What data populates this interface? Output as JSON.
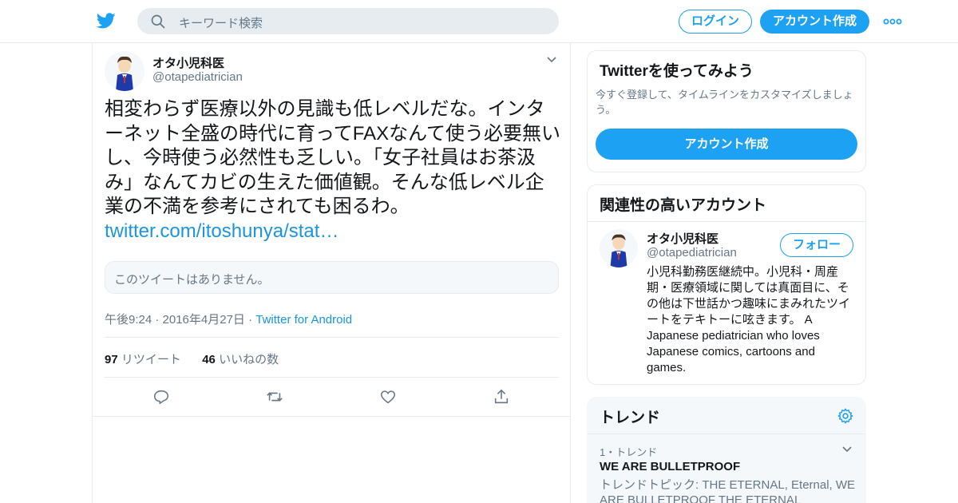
{
  "header": {
    "logo_icon": "twitter-bird-icon",
    "search_placeholder": "キーワード検索",
    "login_label": "ログイン",
    "signup_label": "アカウント作成",
    "more_icon": "more-dots-icon",
    "accent": "#1da1f2"
  },
  "tweet": {
    "author_name": "オタ小児科医",
    "author_handle": "@otapediatrician",
    "text": "相変わらず医療以外の見識も低レベルだな。インターネット全盛の時代に育ってFAXなんて使う必要無いし、今時使う必然性も乏しい。「女子社員はお茶汲み」なんてカビの生えた価値観。そんな低レベル企業の不満を参考にされても困るわ。",
    "link": "twitter.com/itoshunya/stat…",
    "quote_unavailable": "このツイートはありません。",
    "time": "午後9:24 · 2016年4月27日",
    "meta_separator": "·",
    "source": "Twitter for Android",
    "retweet_count": "97",
    "retweet_label": "リツイート",
    "like_count": "46",
    "like_label": "いいねの数",
    "actions": [
      "reply-icon",
      "retweet-icon",
      "like-icon",
      "share-icon"
    ]
  },
  "signup_card": {
    "title": "Twitterを使ってみよう",
    "description": "今すぐ登録して、タイムラインをカスタマイズしましょう。",
    "button": "アカウント作成"
  },
  "related": {
    "title": "関連性の高いアカウント",
    "name": "オタ小児科医",
    "handle": "@otapediatrician",
    "follow_label": "フォロー",
    "bio": "小児科勤務医継続中。小児科・周産期・医療領域に関しては真面目に、その他は下世話かつ趣味にまみれたツイートをテキトーに呟きます。 A Japanese pediatrician who loves Japanese comics, cartoons and games."
  },
  "trends": {
    "title": "トレンド",
    "settings_icon": "gear-icon",
    "rank_label": "1・トレンド",
    "name": "WE ARE BULLETPROOF",
    "description": "トレンドトピック: THE ETERNAL, Eternal, WE ARE BULLETPROOF THE ETERNAL"
  }
}
